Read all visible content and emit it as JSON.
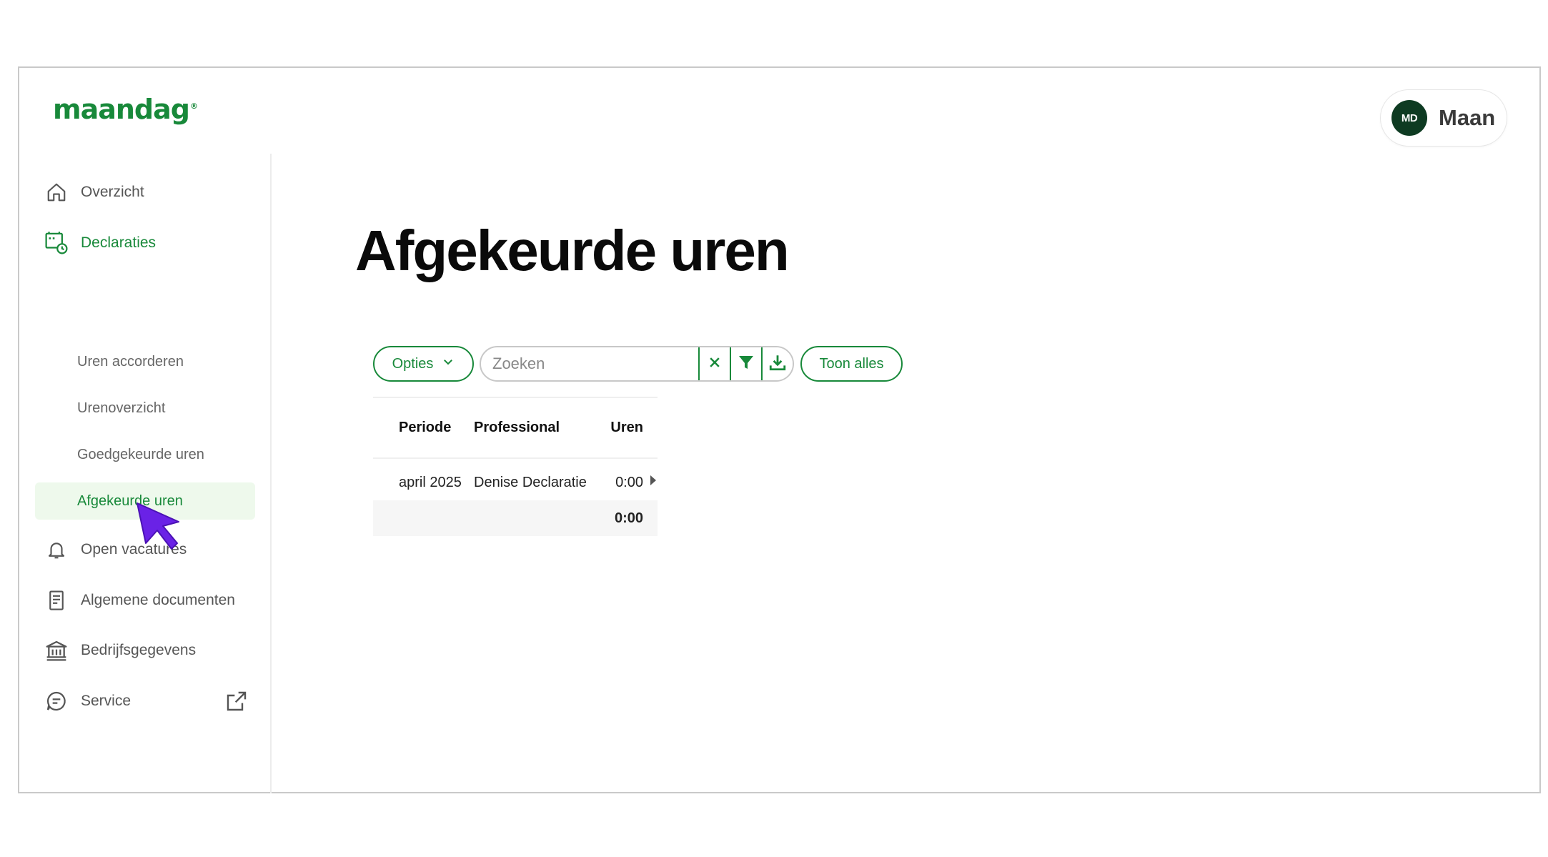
{
  "brand": {
    "logo_text": "maandag",
    "logo_mark": "®",
    "accent": "#18893a"
  },
  "user": {
    "initials": "MD",
    "name": "Maan"
  },
  "sidebar": {
    "items": [
      {
        "label": "Overzicht",
        "icon": "home-icon"
      },
      {
        "label": "Declaraties",
        "icon": "calendar-clock-icon"
      },
      {
        "label": "Uren accorderen"
      },
      {
        "label": "Urenoverzicht"
      },
      {
        "label": "Goedgekeurde uren"
      },
      {
        "label": "Afgekeurde uren"
      },
      {
        "label": "Open vacatures",
        "icon": "bell-icon"
      },
      {
        "label": "Algemene documenten",
        "icon": "document-icon"
      },
      {
        "label": "Bedrijfsgegevens",
        "icon": "building-icon"
      },
      {
        "label": "Service",
        "icon": "chat-icon"
      }
    ]
  },
  "main": {
    "title": "Afgekeurde uren",
    "toolbar": {
      "options_label": "Opties",
      "search_placeholder": "Zoeken",
      "show_all_label": "Toon alles"
    },
    "table": {
      "headers": [
        "Periode",
        "Professional",
        "Uren"
      ],
      "rows": [
        {
          "periode": "april 2025",
          "professional": "Denise Declaratie",
          "uren": "0:00"
        }
      ],
      "total": "0:00"
    }
  }
}
